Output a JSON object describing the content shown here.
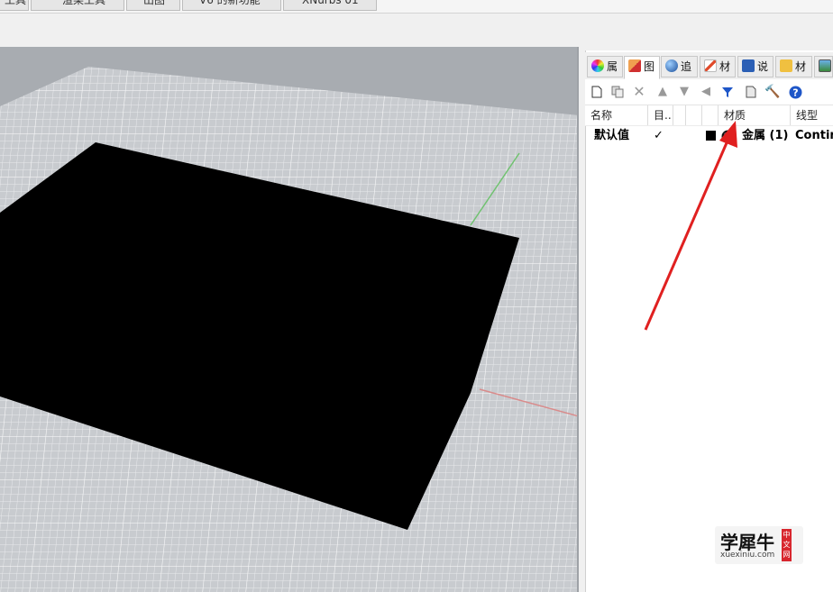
{
  "top_tabs": [
    "工具",
    "渲染工具",
    "出图",
    "V6 的新功能",
    "XNurbs 01"
  ],
  "panel": {
    "tabs": [
      {
        "label": "属",
        "icon": "properties-icon"
      },
      {
        "label": "图",
        "icon": "layers-icon"
      },
      {
        "label": "追",
        "icon": "display-icon"
      },
      {
        "label": "材",
        "icon": "materials-icon"
      },
      {
        "label": "说",
        "icon": "help-icon"
      },
      {
        "label": "材",
        "icon": "library-icon"
      },
      {
        "label": "",
        "icon": "render-icon"
      }
    ],
    "columns": [
      "名称",
      "目..",
      "",
      "",
      "",
      "材质",
      "线型"
    ],
    "rows": [
      {
        "name": "默认值",
        "current": "✓",
        "material": "金属 (1)",
        "linetype": "Contin"
      }
    ]
  },
  "watermark": {
    "title": "学犀牛",
    "url": "xuexiniu.com",
    "badge": "中文网"
  },
  "colors": {
    "accent_red": "#e02020",
    "help_blue": "#1e56c8"
  }
}
